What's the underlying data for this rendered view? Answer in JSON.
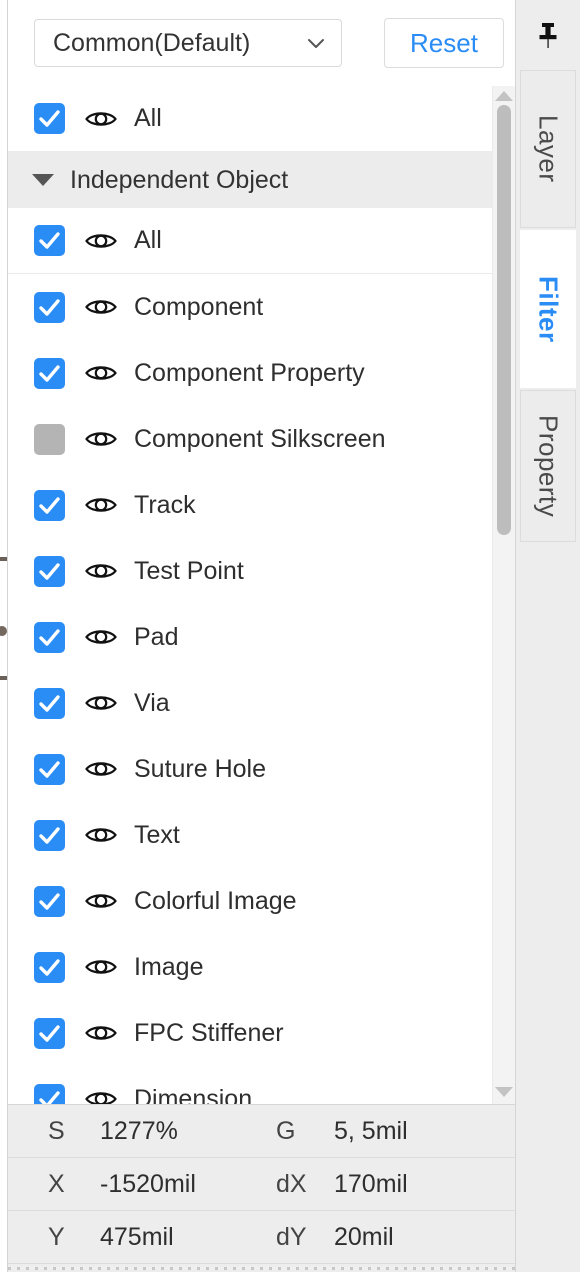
{
  "toolbar": {
    "preset_value": "Common(Default)",
    "preset_chevron_icon": "chevron-down-icon",
    "reset_label": "Reset"
  },
  "filter_list": {
    "top_all": {
      "label": "All",
      "checked": true,
      "visibility_icon": "eye-icon"
    },
    "group": {
      "label": "Independent Object",
      "expanded": true,
      "collapse_icon": "triangle-down-icon",
      "items": [
        {
          "label": "All",
          "checked": true,
          "visibility_icon": "eye-icon"
        },
        {
          "label": "Component",
          "checked": true,
          "visibility_icon": "eye-icon"
        },
        {
          "label": "Component Property",
          "checked": true,
          "visibility_icon": "eye-icon"
        },
        {
          "label": "Component Silkscreen",
          "checked": false,
          "visibility_icon": "eye-icon"
        },
        {
          "label": "Track",
          "checked": true,
          "visibility_icon": "eye-icon"
        },
        {
          "label": "Test Point",
          "checked": true,
          "visibility_icon": "eye-icon"
        },
        {
          "label": "Pad",
          "checked": true,
          "visibility_icon": "eye-icon"
        },
        {
          "label": "Via",
          "checked": true,
          "visibility_icon": "eye-icon"
        },
        {
          "label": "Suture Hole",
          "checked": true,
          "visibility_icon": "eye-icon"
        },
        {
          "label": "Text",
          "checked": true,
          "visibility_icon": "eye-icon"
        },
        {
          "label": "Colorful Image",
          "checked": true,
          "visibility_icon": "eye-icon"
        },
        {
          "label": "Image",
          "checked": true,
          "visibility_icon": "eye-icon"
        },
        {
          "label": "FPC Stiffener",
          "checked": true,
          "visibility_icon": "eye-icon"
        },
        {
          "label": "Dimension",
          "checked": true,
          "visibility_icon": "eye-icon"
        }
      ]
    },
    "scrollbar": {
      "up_arrow_icon": "triangle-up-icon",
      "down_arrow_icon": "triangle-down-icon"
    }
  },
  "statusbar": {
    "rows": [
      {
        "key1": "S",
        "val1": "1277%",
        "key2": "G",
        "val2": "5, 5mil"
      },
      {
        "key1": "X",
        "val1": "-1520mil",
        "key2": "dX",
        "val2": "170mil"
      },
      {
        "key1": "Y",
        "val1": "475mil",
        "key2": "dY",
        "val2": "20mil"
      }
    ]
  },
  "tabstrip": {
    "pin_icon": "pushpin-icon",
    "tabs": [
      {
        "label": "Layer",
        "active": false
      },
      {
        "label": "Filter",
        "active": true
      },
      {
        "label": "Property",
        "active": false
      }
    ]
  },
  "colors": {
    "accent": "#2a8cf5",
    "checkbox_on": "#2a8cf5",
    "checkbox_off": "#b4b4b4",
    "group_header_bg": "#ececec",
    "statusbar_bg": "#ededed"
  }
}
